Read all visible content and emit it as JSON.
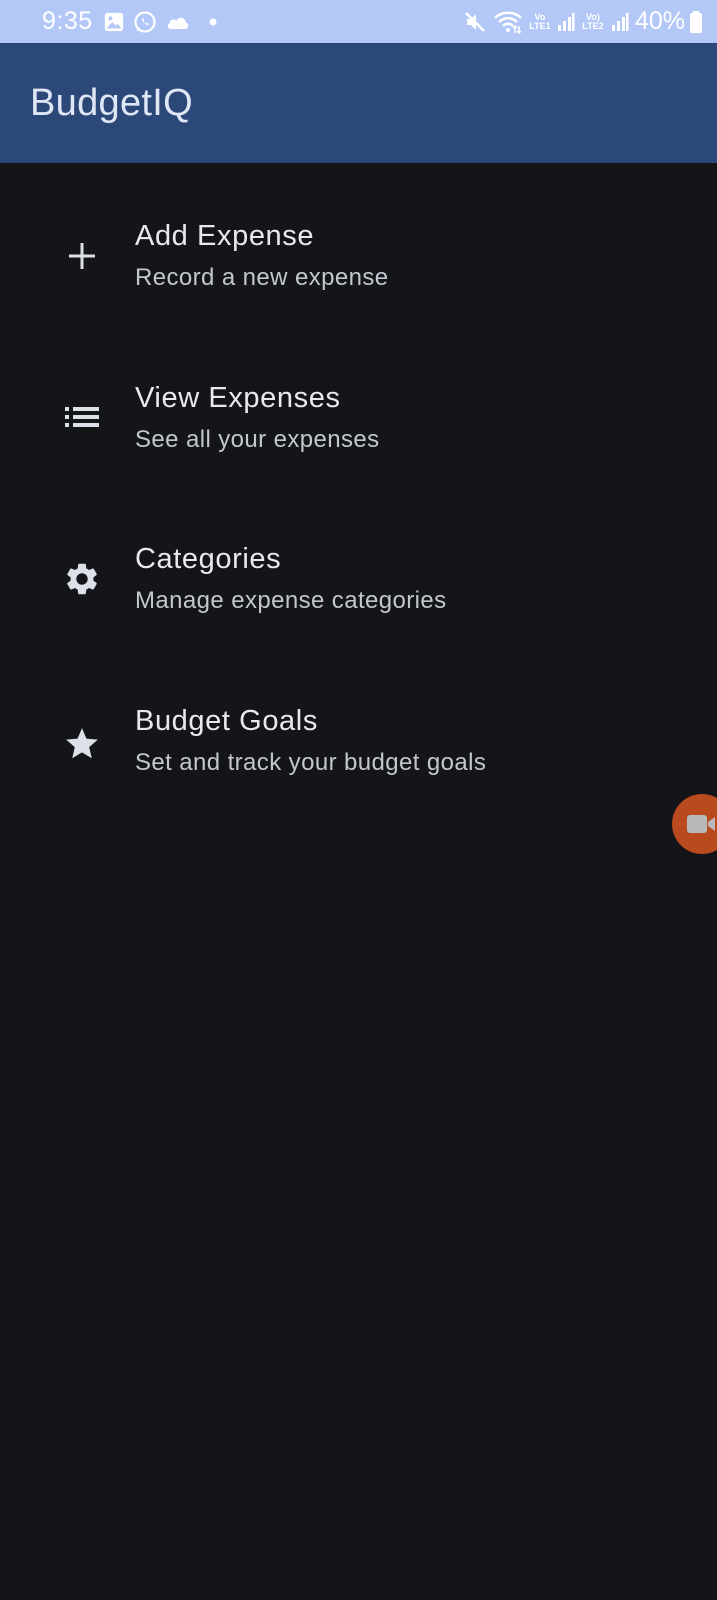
{
  "status_bar": {
    "time": "9:35",
    "battery": "40%",
    "lte1": "Vo LTE1",
    "lte2": "Vo) LTE2",
    "icons": [
      "gallery-icon",
      "whatsapp-icon",
      "cloud-icon",
      "dot-icon",
      "mute-icon",
      "wifi-icon",
      "signal-icon",
      "signal-icon",
      "battery-icon"
    ]
  },
  "app_bar": {
    "title": "BudgetIQ"
  },
  "menu": {
    "items": [
      {
        "title": "Add Expense",
        "subtitle": "Record a new expense",
        "icon": "plus-icon"
      },
      {
        "title": "View Expenses",
        "subtitle": "See all your expenses",
        "icon": "list-icon"
      },
      {
        "title": "Categories",
        "subtitle": "Manage expense categories",
        "icon": "gear-icon"
      },
      {
        "title": "Budget Goals",
        "subtitle": "Set and track your budget goals",
        "icon": "star-icon"
      }
    ]
  },
  "floating_button": {
    "icon": "video-camera-icon",
    "color": "#b84a1d"
  },
  "colors": {
    "status_bar": "#b3c8f6",
    "app_bar": "#2c4878",
    "background": "#141518",
    "title_text": "#e8e9ee",
    "subtitle_text": "#c4c6cf",
    "icon": "#dde0e8"
  }
}
